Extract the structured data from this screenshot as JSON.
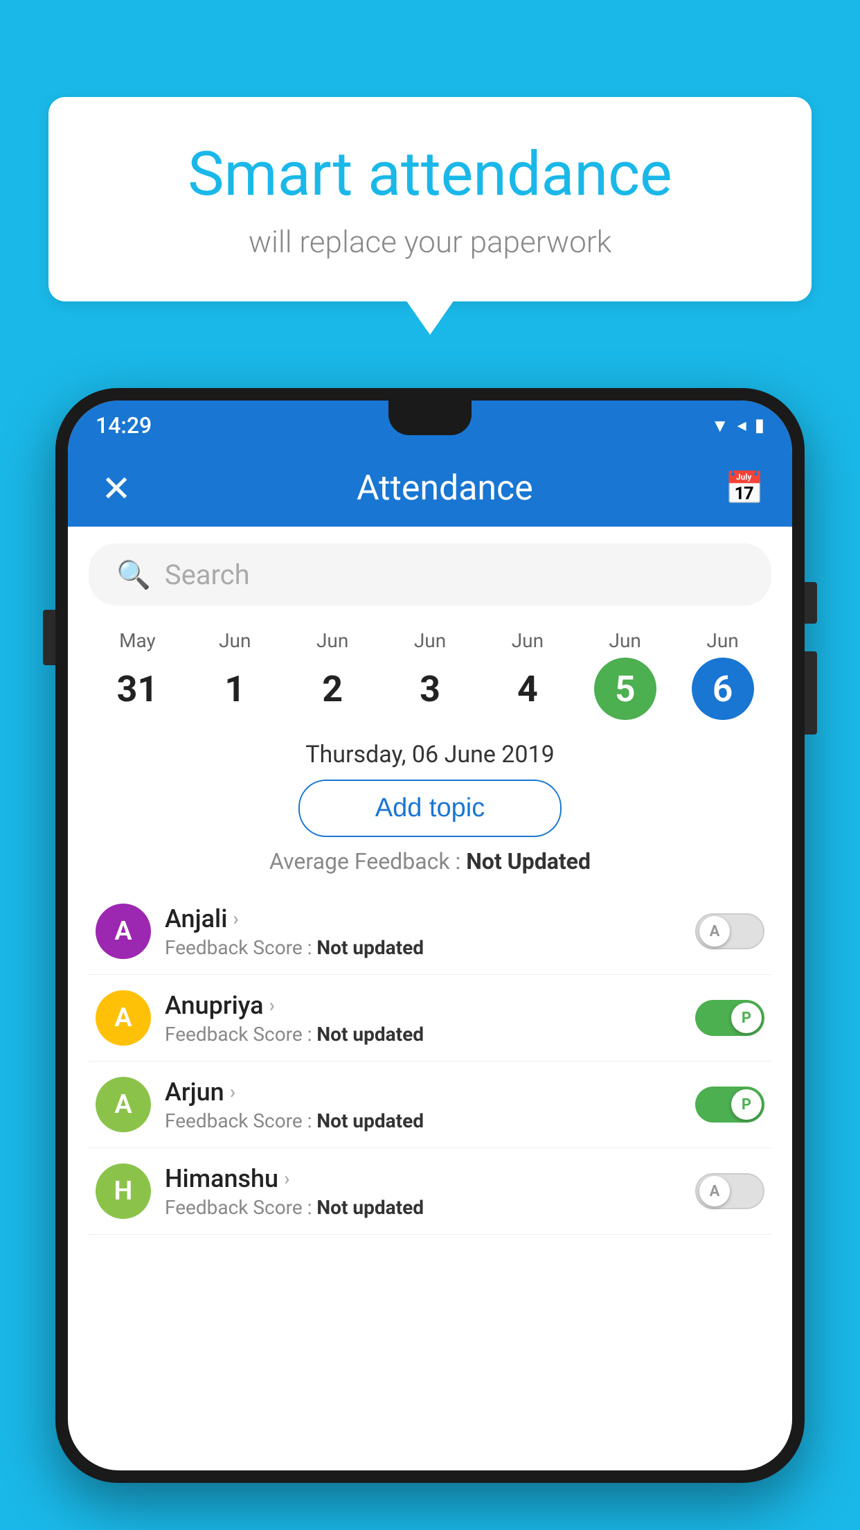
{
  "bubble": {
    "title": "Smart attendance",
    "subtitle": "will replace your paperwork"
  },
  "phone": {
    "status": {
      "time": "14:29",
      "icons": [
        "wifi",
        "signal",
        "battery"
      ]
    },
    "appBar": {
      "title": "Attendance",
      "closeIcon": "✕",
      "calendarIcon": "📅"
    },
    "search": {
      "placeholder": "Search"
    },
    "calendar": {
      "days": [
        {
          "month": "May",
          "date": "31",
          "state": "normal"
        },
        {
          "month": "Jun",
          "date": "1",
          "state": "normal"
        },
        {
          "month": "Jun",
          "date": "2",
          "state": "normal"
        },
        {
          "month": "Jun",
          "date": "3",
          "state": "normal"
        },
        {
          "month": "Jun",
          "date": "4",
          "state": "normal"
        },
        {
          "month": "Jun",
          "date": "5",
          "state": "today"
        },
        {
          "month": "Jun",
          "date": "6",
          "state": "selected"
        }
      ]
    },
    "selectedDate": "Thursday, 06 June 2019",
    "addTopicLabel": "Add topic",
    "avgFeedbackLabel": "Average Feedback : ",
    "avgFeedbackValue": "Not Updated",
    "students": [
      {
        "name": "Anjali",
        "initial": "A",
        "avatarColor": "#9C27B0",
        "feedback": "Feedback Score : ",
        "feedbackValue": "Not updated",
        "toggleState": "off",
        "toggleLabel": "A"
      },
      {
        "name": "Anupriya",
        "initial": "A",
        "avatarColor": "#FFC107",
        "feedback": "Feedback Score : ",
        "feedbackValue": "Not updated",
        "toggleState": "on",
        "toggleLabel": "P"
      },
      {
        "name": "Arjun",
        "initial": "A",
        "avatarColor": "#8BC34A",
        "feedback": "Feedback Score : ",
        "feedbackValue": "Not updated",
        "toggleState": "on",
        "toggleLabel": "P"
      },
      {
        "name": "Himanshu",
        "initial": "H",
        "avatarColor": "#8BC34A",
        "feedback": "Feedback Score : ",
        "feedbackValue": "Not updated",
        "toggleState": "off",
        "toggleLabel": "A"
      }
    ]
  },
  "backgroundColor": "#1AB8E8",
  "appBarColor": "#1976D2"
}
